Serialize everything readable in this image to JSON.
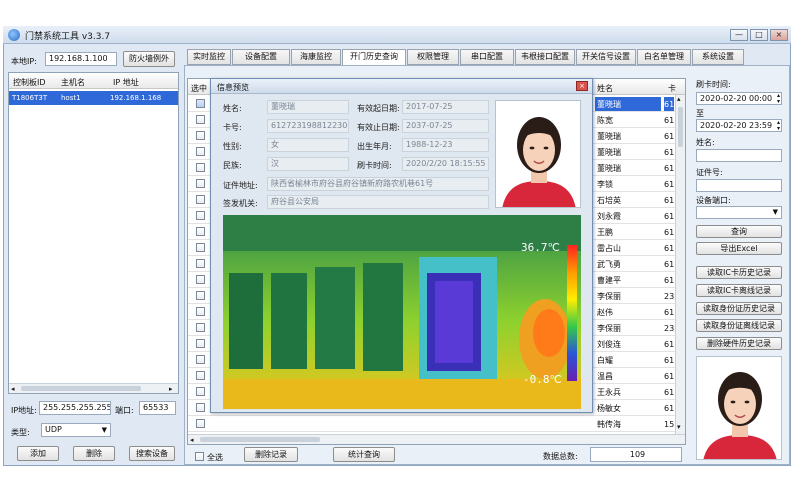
{
  "window": {
    "title": "门禁系统工具 v3.3.7",
    "min": "—",
    "max": "□",
    "close": "×"
  },
  "left": {
    "local_ip_label": "本地IP:",
    "local_ip_value": "192.168.1.100",
    "firewall_button": "防火墙例外",
    "columns": [
      "控制板ID",
      "主机名",
      "IP 地址"
    ],
    "rows": [
      {
        "id": "T1806T3T",
        "host": "host1",
        "ip": "192.168.1.168"
      }
    ],
    "ip_label": "IP地址:",
    "ip_value": "255.255.255.255",
    "port_label": "端口:",
    "port_value": "65533",
    "type_label": "类型:",
    "type_value": "UDP",
    "add_button": "添加",
    "delete_button": "删除",
    "search_button": "搜索设备"
  },
  "tabs": [
    "实时监控",
    "设备配置",
    "海康监控",
    "开门历史查询",
    "权限管理",
    "串口配置",
    "韦根接口配置",
    "开关信号设置",
    "白名单管理",
    "系统设置"
  ],
  "active_tab": 3,
  "grid": {
    "select_header": "选中",
    "name_header": "姓名",
    "col3_header": "卡",
    "rows": [
      {
        "name": "董晓瑞",
        "v": "61"
      },
      {
        "name": "陈宽",
        "v": "61"
      },
      {
        "name": "董晓瑞",
        "v": "61"
      },
      {
        "name": "董晓瑞",
        "v": "61"
      },
      {
        "name": "董晓瑞",
        "v": "61"
      },
      {
        "name": "李锁",
        "v": "61"
      },
      {
        "name": "石培英",
        "v": "61"
      },
      {
        "name": "刘永霞",
        "v": "61"
      },
      {
        "name": "王鹏",
        "v": "61"
      },
      {
        "name": "雷占山",
        "v": "61"
      },
      {
        "name": "武飞勇",
        "v": "61"
      },
      {
        "name": "曹建平",
        "v": "61"
      },
      {
        "name": "李保丽",
        "v": "23"
      },
      {
        "name": "赵伟",
        "v": "61"
      },
      {
        "name": "李保丽",
        "v": "23"
      },
      {
        "name": "刘俊连",
        "v": "61"
      },
      {
        "name": "白耀",
        "v": "61"
      },
      {
        "name": "温昌",
        "v": "61"
      },
      {
        "name": "王永兵",
        "v": "61"
      },
      {
        "name": "杨敏女",
        "v": "61"
      },
      {
        "name": "韩传海",
        "v": "15"
      }
    ],
    "select_all_label": "全选",
    "delete_records_button": "删除记录",
    "stats_query_button": "统计查询",
    "total_label": "数据总数:",
    "total_value": "109"
  },
  "dialog": {
    "title": "信息预览",
    "name_label": "姓名:",
    "name_value": "董晓瑞",
    "valid_start_label": "有效起日期:",
    "valid_start_value": "2017-07-25",
    "card_label": "卡号:",
    "card_value": "612723198812230026",
    "valid_end_label": "有效止日期:",
    "valid_end_value": "2037-07-25",
    "gender_label": "性别:",
    "gender_value": "女",
    "birth_label": "出生年月:",
    "birth_value": "1988-12-23",
    "nation_label": "民族:",
    "nation_value": "汉",
    "swipe_label": "刷卡时间:",
    "swipe_value": "2020/2/20 18:15:55",
    "address_label": "证件地址:",
    "address_value": "陕西省榆林市府谷县府谷镇新府路农机巷61号",
    "issuer_label": "签发机关:",
    "issuer_value": "府谷县公安局",
    "temp_high": "36.7℃",
    "temp_low": "-0.8℃"
  },
  "right": {
    "swipe_time_label": "刷卡时间:",
    "from_value": "2020-02-20 00:00",
    "to_label": "至",
    "to_value": "2020-02-20 23:59",
    "name_label": "姓名:",
    "id_label": "证件号:",
    "device_port_label": "设备端口:",
    "query_button": "查询",
    "export_button": "导出Excel",
    "btn_ic_history": "读取IC卡历史记录",
    "btn_ic_offline": "读取IC卡离线记录",
    "btn_id_history": "读取身份证历史记录",
    "btn_id_offline": "读取身份证离线记录",
    "btn_delete_hw": "删除硬件历史记录"
  },
  "colors": {
    "accent_blue": "#3b6fd1",
    "selected_row": "#2f68d8",
    "window_bg": "#dfe8f3"
  }
}
